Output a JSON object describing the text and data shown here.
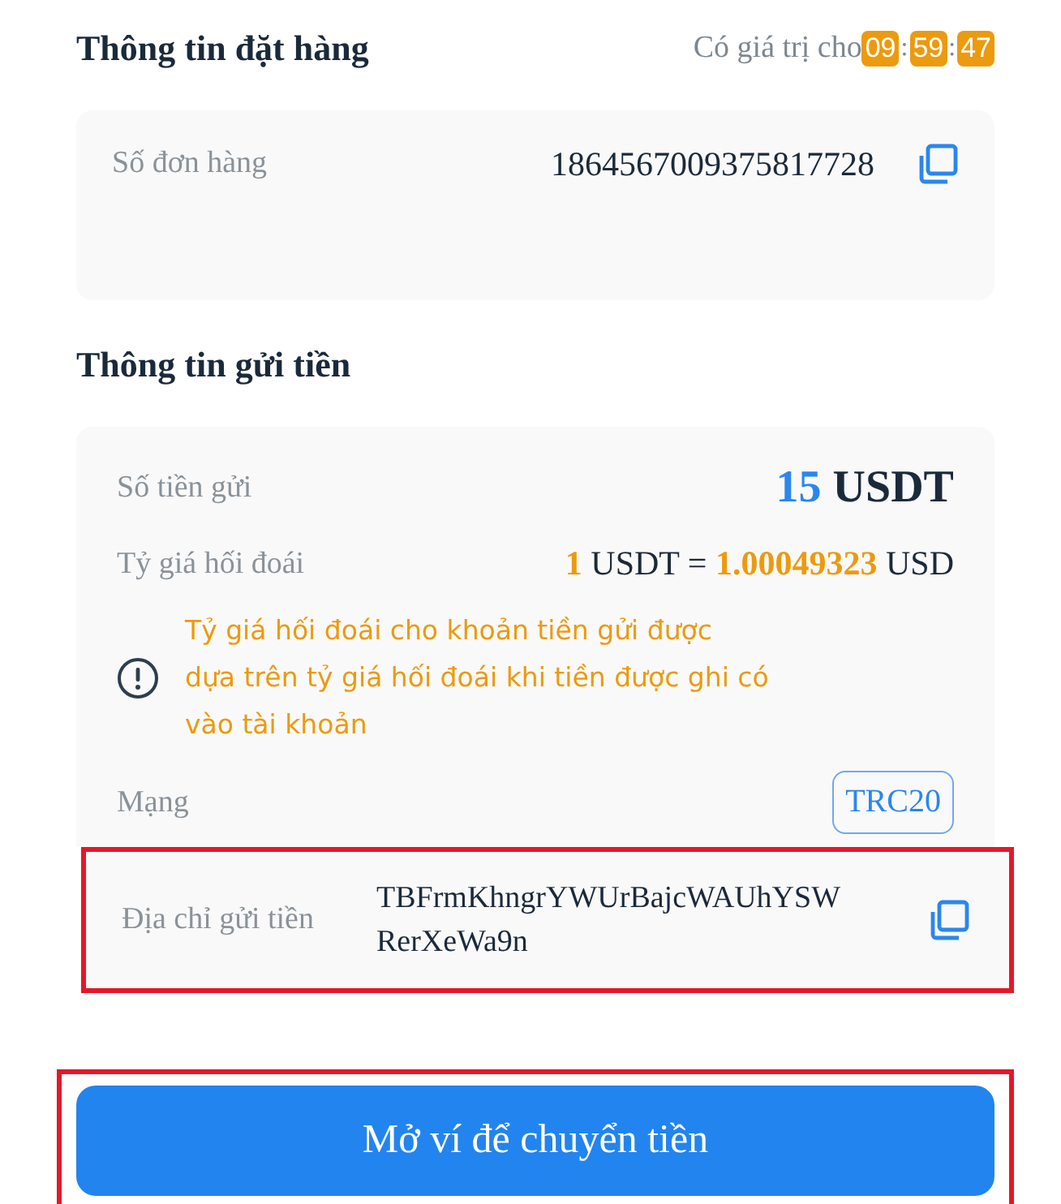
{
  "order_info": {
    "title": "Thông tin đặt hàng",
    "validity_label": "Có giá trị cho",
    "countdown": [
      {
        "kind": "digits",
        "text": "09"
      },
      {
        "kind": "separator",
        "text": ":"
      },
      {
        "kind": "digits",
        "text": "59"
      },
      {
        "kind": "separator",
        "text": ":"
      },
      {
        "kind": "digits",
        "text": "47"
      }
    ],
    "order_number_label": "Số đơn hàng",
    "order_number": "1864567009375817728"
  },
  "deposit_info": {
    "title": "Thông tin gửi tiền",
    "amount_label": "Số tiền gửi",
    "amount": "15",
    "amount_unit": "USDT",
    "rate_label": "Tỷ giá hối đoái",
    "rate_from_amount": "1",
    "rate_from_unit": "USDT =",
    "rate_to_amount": "1.00049323",
    "rate_to_unit": "USD",
    "notice": "Tỷ giá hối đoái cho khoản tiền gửi được dựa trên tỷ giá hối đoái khi tiền được ghi có vào tài khoản",
    "network_label": "Mạng",
    "network": "TRC20",
    "address_label": "Địa chỉ gửi tiền",
    "address": "TBFrmKhngrYWUrBajcWAUhYSWRerXeWa9n",
    "address_highlighted": true
  },
  "open_wallet_button": {
    "label": "Mở ví để chuyển tiền",
    "highlighted": true
  }
}
